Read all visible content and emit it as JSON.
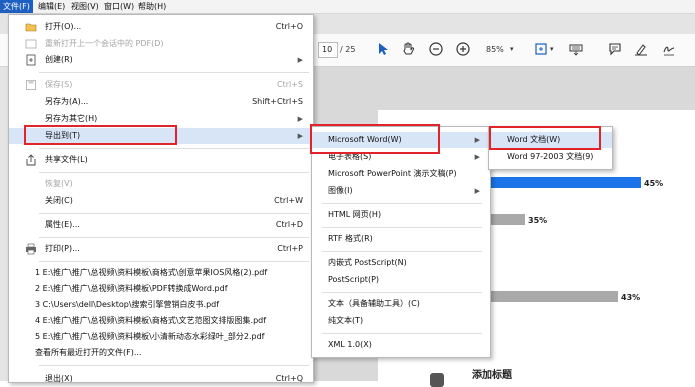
{
  "menubar": [
    {
      "label": "文件(F)",
      "active": true
    },
    {
      "label": "编辑(E)",
      "active": false
    },
    {
      "label": "视图(V)",
      "active": false
    },
    {
      "label": "窗口(W)",
      "active": false
    },
    {
      "label": "帮助(H)",
      "active": false
    }
  ],
  "toolbar": {
    "page_current": "10",
    "page_total": "/ 25",
    "zoom": "85%"
  },
  "chart": {
    "bar1_label": "45%",
    "bar2_label": "35%",
    "bar3_label": "43%",
    "section_title": "添加标题",
    "colors": {
      "bar_primary": "#1a73e8",
      "bar_secondary": "#a9a9a9"
    }
  },
  "file_menu": {
    "open": "打开(O)...",
    "open_sc": "Ctrl+O",
    "reopen": "重新打开上一个会话中的 PDF(D)",
    "create": "创建(R)",
    "save": "保存(S)",
    "save_sc": "Ctrl+S",
    "save_as": "另存为(A)...",
    "save_as_sc": "Shift+Ctrl+S",
    "save_as_other": "另存为其它(H)",
    "export_to": "导出到(T)",
    "share": "共享文件(L)",
    "revert": "恢复(V)",
    "close": "关闭(C)",
    "close_sc": "Ctrl+W",
    "properties": "属性(E)...",
    "properties_sc": "Ctrl+D",
    "print": "打印(P)...",
    "print_sc": "Ctrl+P",
    "recent": [
      "1 E:\\推广\\推广\\总视频\\资料模板\\商格式\\创意苹果IOS风格(2).pdf",
      "2 E:\\推广\\推广\\总视频\\资料模板\\PDF转换成Word.pdf",
      "3 C:\\Users\\dell\\Desktop\\搜索引擎营销白皮书.pdf",
      "4 E:\\推广\\推广\\总视频\\资料模板\\商格式\\文艺范图文排版图集.pdf",
      "5 E:\\推广\\推广\\总视频\\资料模板\\小清新动态水彩绿叶_部分2.pdf"
    ],
    "view_all_recent": "查看所有最近打开的文件(F)...",
    "exit": "退出(X)",
    "exit_sc": "Ctrl+Q"
  },
  "export_menu": {
    "word": "Microsoft Word(W)",
    "excel": "电子表格(S)",
    "powerpoint": "Microsoft PowerPoint 演示文稿(P)",
    "image": "图像(I)",
    "html": "HTML 网页(H)",
    "rtf": "RTF 格式(R)",
    "eps": "内嵌式 PostScript(N)",
    "ps": "PostScript(P)",
    "text_access": "文本（具备辅助工具）(C)",
    "text_plain": "纯文本(T)",
    "xml": "XML 1.0(X)"
  },
  "word_menu": {
    "docx": "Word 文档(W)",
    "doc": "Word 97-2003 文档(9)"
  }
}
